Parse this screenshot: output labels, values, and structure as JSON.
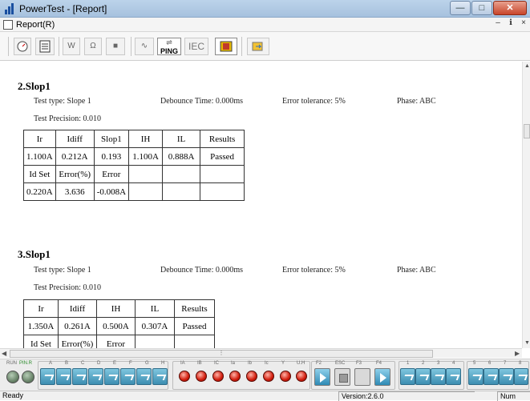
{
  "window": {
    "title": "PowerTest - [Report]"
  },
  "menu": {
    "items": [
      {
        "label": "Report(R)"
      }
    ]
  },
  "toolbar": {
    "ping_label": "PING",
    "iec_label": "IEC"
  },
  "sections": [
    {
      "title": "2.Slop1",
      "test_type": "Test type: Slope 1",
      "debounce": "Debounce Time: 0.000ms",
      "tolerance": "Error tolerance: 5%",
      "phase": "Phase: ABC",
      "precision": "Test Precision: 0.010",
      "table": [
        [
          "Ir",
          "Idiff",
          "Slop1",
          "IH",
          "IL",
          "Results"
        ],
        [
          "1.100A",
          "0.212A",
          "0.193",
          "1.100A",
          "0.888A",
          "Passed"
        ],
        [
          "Id Set",
          "Error(%)",
          "Error",
          "",
          "",
          ""
        ],
        [
          "0.220A",
          "3.636",
          "-0.008A",
          "",
          "",
          ""
        ]
      ]
    },
    {
      "title": "3.Slop1",
      "test_type": "Test type: Slope 1",
      "debounce": "Debounce Time: 0.000ms",
      "tolerance": "Error tolerance: 5%",
      "phase": "Phase: ABC",
      "precision": "Test Precision: 0.010",
      "table": [
        [
          "Ir",
          "Idiff",
          "IH",
          "IL",
          "Results"
        ],
        [
          "1.350A",
          "0.261A",
          "0.500A",
          "0.307A",
          "Passed"
        ],
        [
          "Id Set",
          "Error(%)",
          "Error",
          "",
          ""
        ]
      ]
    }
  ],
  "controls": {
    "run_label": "RUN",
    "pinlr_label": "PIN.R",
    "binary_labels": [
      "A",
      "B",
      "C",
      "D",
      "E",
      "F",
      "G",
      "H"
    ],
    "analog_labels": [
      "IA",
      "IB",
      "IC",
      "Ia",
      "Ib",
      "Ic",
      "Y",
      "U.H"
    ],
    "fkeys": [
      "F2",
      "ESC",
      "F3",
      "F4"
    ],
    "outputs": [
      "1",
      "2",
      "3",
      "4",
      "5",
      "6",
      "7",
      "8"
    ]
  },
  "status": {
    "left": "Ready",
    "version": "Version:2.6.0",
    "num": "Num"
  }
}
